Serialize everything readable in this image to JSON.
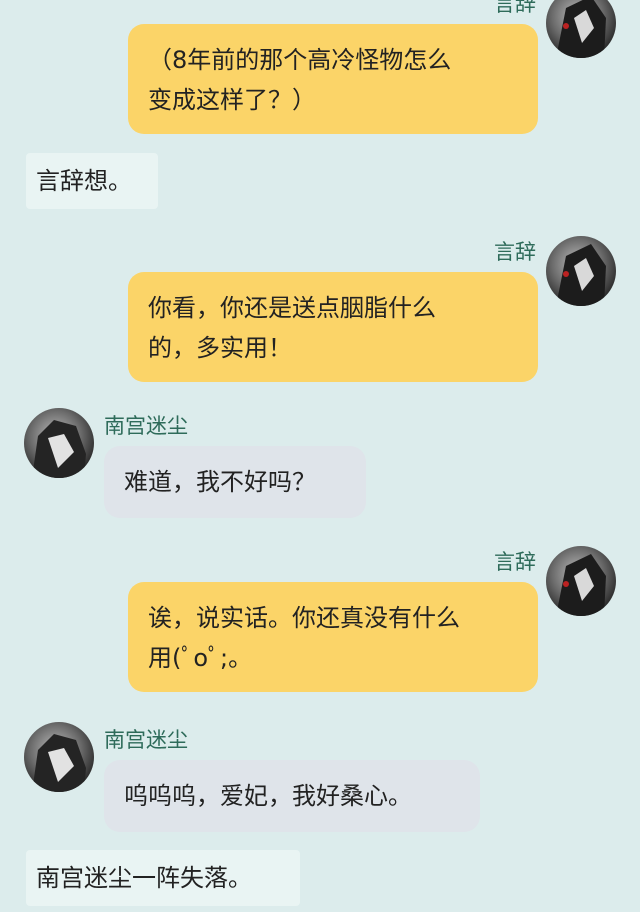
{
  "messages": [
    {
      "id": "m1",
      "speaker": "言辞",
      "text_lines": [
        "（8年前的那个高冷怪物怎么",
        "变成这样了？）"
      ]
    },
    {
      "id": "n1",
      "narration": "言辞想。"
    },
    {
      "id": "m2",
      "speaker": "言辞",
      "text_lines": [
        "你看，你还是送点胭脂什么",
        "的，多实用！"
      ]
    },
    {
      "id": "m3",
      "speaker": "南宫迷尘",
      "text_lines": [
        "难道，我不好吗？"
      ]
    },
    {
      "id": "m4",
      "speaker": "言辞",
      "text_lines": [
        "诶，说实话。你还真没有什么",
        "用(ﾟoﾟ;。"
      ]
    },
    {
      "id": "m5",
      "speaker": "南宫迷尘",
      "text_lines": [
        "呜呜呜，爱妃，我好桑心。"
      ]
    },
    {
      "id": "n2",
      "narration": "南宫迷尘一阵失落。"
    }
  ],
  "colors": {
    "background": "#dcecec",
    "right_bubble": "#fbd468",
    "left_bubble": "#dfe4ea",
    "narration_bg": "#e9f4f3",
    "name_text": "#2e6b5a"
  }
}
